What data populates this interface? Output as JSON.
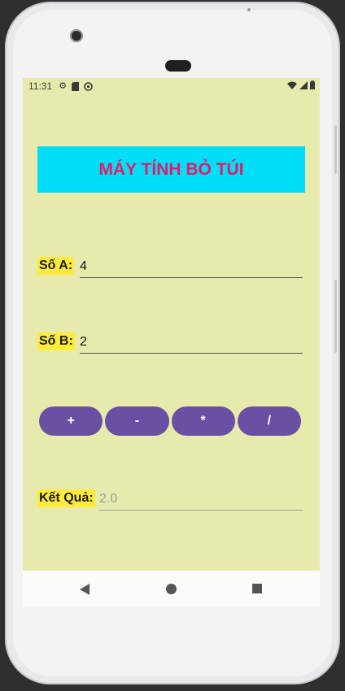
{
  "status_bar": {
    "time": "11:31",
    "left_icons": [
      "gear-icon",
      "sd-card-icon",
      "sync-icon"
    ],
    "right_icons": [
      "wifi-icon",
      "signal-icon",
      "battery-icon"
    ]
  },
  "app": {
    "title": "MÁY TÍNH BỎ TÚI",
    "field_a": {
      "label": "Số A:",
      "value": "4"
    },
    "field_b": {
      "label": "Số B:",
      "value": "2"
    },
    "operators": [
      "+",
      "-",
      "*",
      "/"
    ],
    "result": {
      "label": "Kết Quả:",
      "value": "2.0"
    }
  },
  "colors": {
    "screen_bg": "#e6ebad",
    "title_bg": "#00ddf7",
    "title_text": "#e01d6b",
    "label_bg": "#ffeb3b",
    "button_bg": "#6a50a2"
  },
  "nav_bar": [
    "back-icon",
    "home-icon",
    "recents-icon"
  ]
}
